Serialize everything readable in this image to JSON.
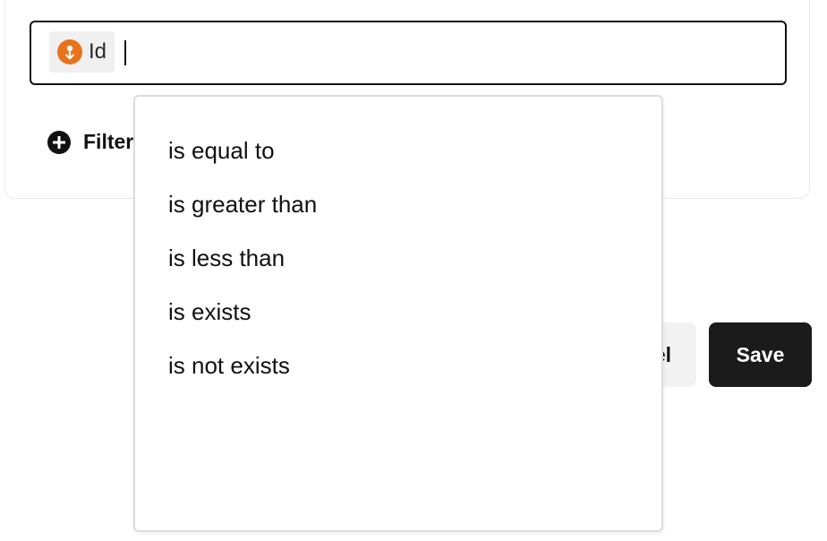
{
  "filter": {
    "field_chip": {
      "icon": "person-pin-icon",
      "icon_color": "#e8731a",
      "label": "Id"
    },
    "input_value": ""
  },
  "add_filter": {
    "icon": "plus-circle-icon",
    "label": "Filter"
  },
  "actions": {
    "cancel_label": "el",
    "save_label": "Save"
  },
  "operator_dropdown": {
    "options": [
      {
        "label": "is equal to"
      },
      {
        "label": "is greater than"
      },
      {
        "label": "is less than"
      },
      {
        "label": "is exists"
      },
      {
        "label": "is not exists"
      }
    ]
  }
}
